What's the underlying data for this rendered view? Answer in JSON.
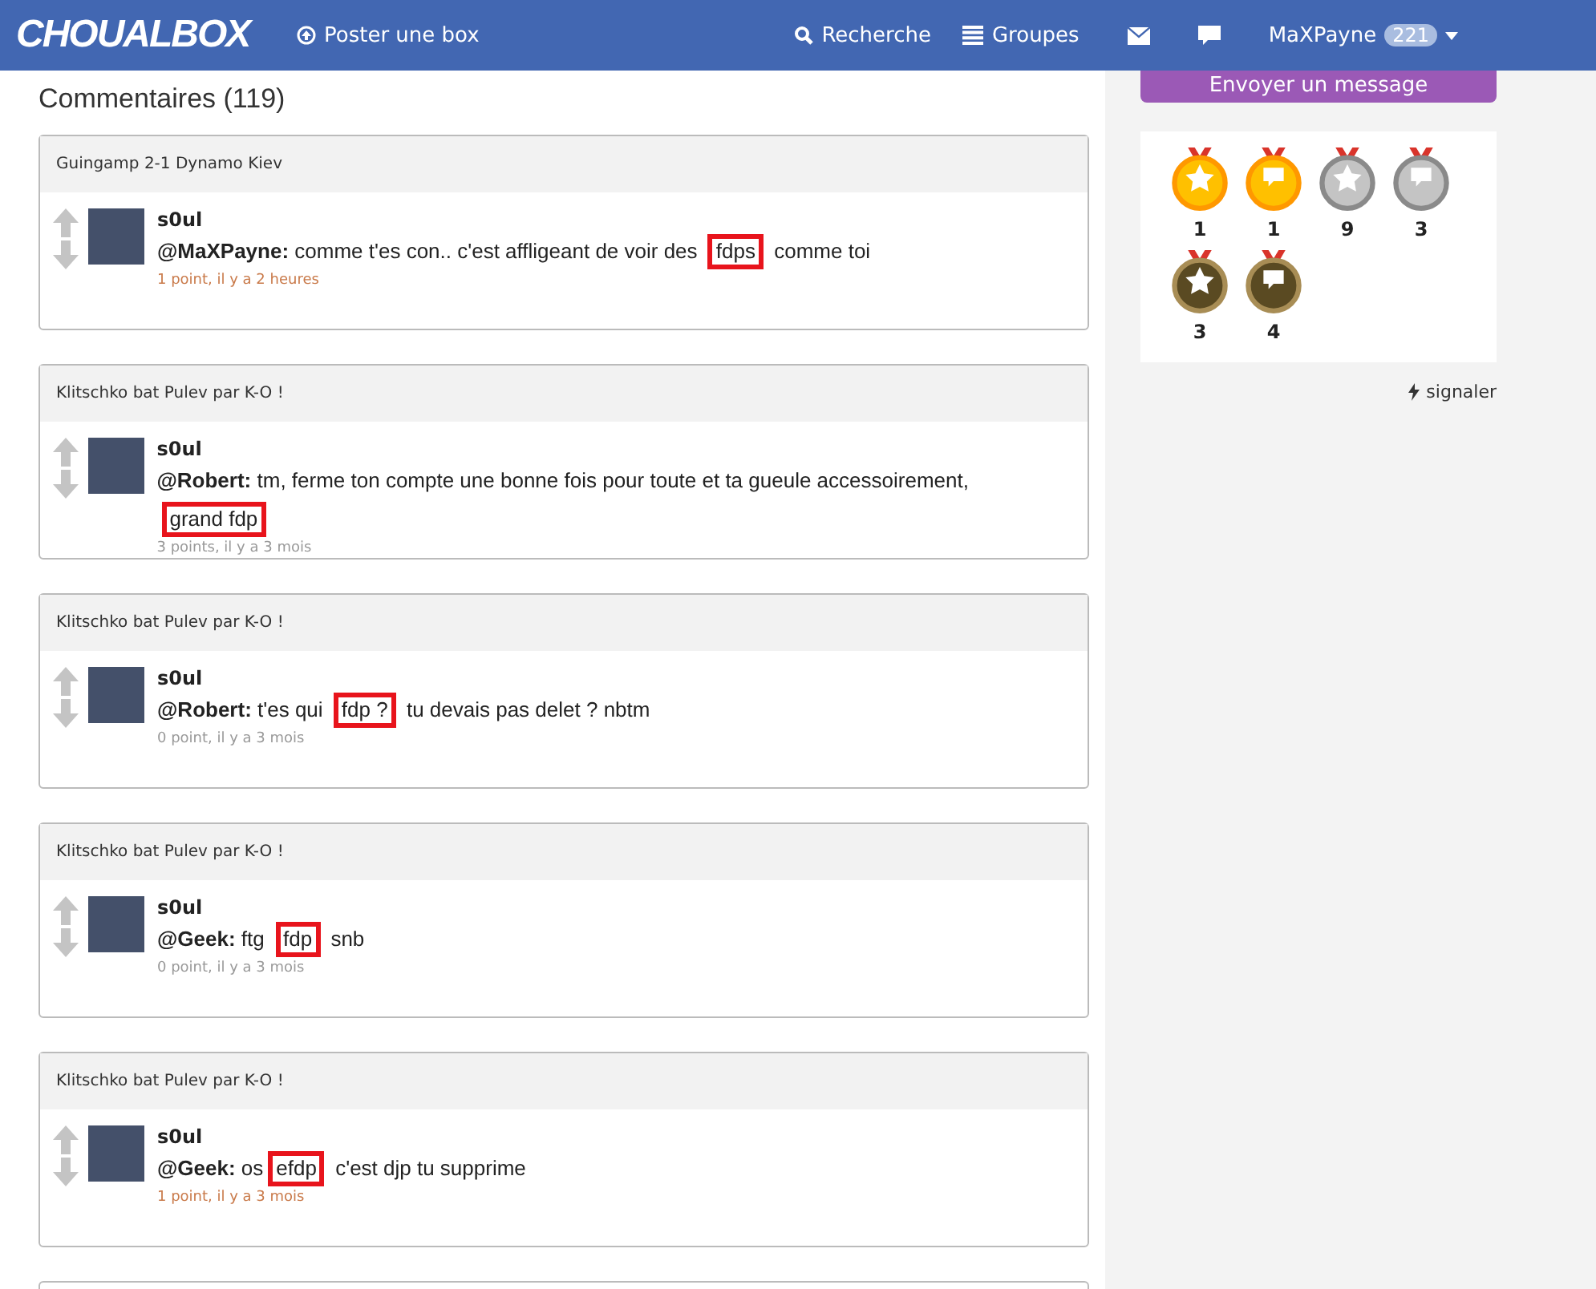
{
  "navbar": {
    "logo": "CHOUALBOX",
    "post_link": "Poster une box",
    "search_link": "Recherche",
    "groups_link": "Groupes",
    "user": {
      "name": "MaXPayne",
      "badge": "221"
    }
  },
  "comments_heading": "Commentaires (119)",
  "comments": [
    {
      "topic": "Guingamp 2-1 Dynamo Kiev",
      "author": "s0ul",
      "mention": "@MaXPayne:",
      "before": " comme t'es con.. c'est affligeant de voir des ",
      "marked": "fdps",
      "after": " comme toi",
      "meta": "1 point, il y a 2 heures",
      "positive": true
    },
    {
      "topic": "Klitschko bat Pulev par K-O !",
      "author": "s0ul",
      "mention": "@Robert:",
      "before": " tm, ferme ton compte une bonne fois pour toute et ta gueule accessoirement, ",
      "marked": "grand fdp",
      "meta": "3 points, il y a 3 mois",
      "positive": false
    },
    {
      "topic": "Klitschko bat Pulev par K-O !",
      "author": "s0ul",
      "mention": "@Robert:",
      "before": " t'es qui ",
      "marked": "fdp ?",
      "after": " tu devais pas delet ? nbtm",
      "meta": "0 point, il y a 3 mois",
      "positive": false
    },
    {
      "topic": "Klitschko bat Pulev par K-O !",
      "author": "s0ul",
      "mention": "@Geek:",
      "before": " ftg ",
      "marked": "fdp",
      "after": " snb",
      "meta": "0 point, il y a 3 mois",
      "positive": false
    },
    {
      "topic": "Klitschko bat Pulev par K-O !",
      "author": "s0ul",
      "mention": "@Geek:",
      "before": " os",
      "marked": "efdp",
      "after": " c'est djp tu supprime",
      "meta": "1 point, il y a 3 mois",
      "positive": true
    }
  ],
  "sidebar": {
    "message_button": "Envoyer un message",
    "medals": [
      {
        "kind": "star",
        "color": "#ffc000",
        "count": "1"
      },
      {
        "kind": "comment",
        "color": "#ffc000",
        "count": "1"
      },
      {
        "kind": "star",
        "color": "#c4c4c4",
        "count": "9"
      },
      {
        "kind": "comment",
        "color": "#c4c4c4",
        "count": "3"
      },
      {
        "kind": "star",
        "color": "#5a4a22",
        "count": "3"
      },
      {
        "kind": "comment",
        "color": "#5a4a22",
        "count": "4"
      }
    ],
    "report_link": "signaler"
  }
}
